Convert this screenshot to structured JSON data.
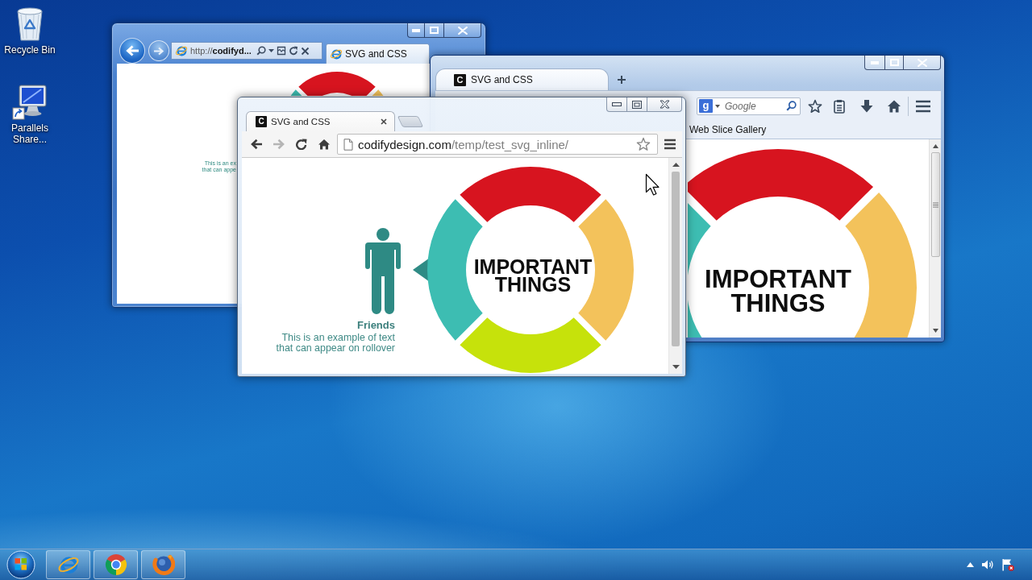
{
  "desktop": {
    "icons": [
      {
        "kind": "recycle_bin",
        "label": "Recycle Bin"
      },
      {
        "kind": "shortcut",
        "label": "Parallels Share..."
      }
    ]
  },
  "ie_window": {
    "address": "http://**codifyd...**",
    "tab": {
      "title": "SVG and CSS"
    },
    "page_text": [
      "This is an ex",
      "that can appe"
    ]
  },
  "firefox_window": {
    "tab": {
      "favicon": "C",
      "title": "SVG and CSS"
    },
    "search": {
      "engine": "g",
      "placeholder": "Google"
    },
    "bookmarks": [
      "Web Slice Gallery"
    ],
    "page": {
      "center_text": "IMPORTANT THINGS"
    }
  },
  "chrome_window": {
    "tab": {
      "favicon": "C",
      "title": "SVG and CSS"
    },
    "nav_buttons": [
      {
        "kind": "back",
        "disabled": false
      },
      {
        "kind": "forward",
        "disabled": true
      },
      {
        "kind": "reload",
        "disabled": false
      },
      {
        "kind": "home",
        "disabled": false
      }
    ],
    "address": {
      "host": "codifydesign.com",
      "path": "/temp/test_svg_inline/"
    },
    "page": {
      "title": "Friends",
      "description": "This is an example of text that can appear on rollover",
      "center_text": "IMPORTANT THINGS"
    }
  },
  "taskbar": {
    "pinned": [
      {
        "kind": "ie"
      },
      {
        "kind": "chrome"
      },
      {
        "kind": "firefox"
      }
    ]
  }
}
